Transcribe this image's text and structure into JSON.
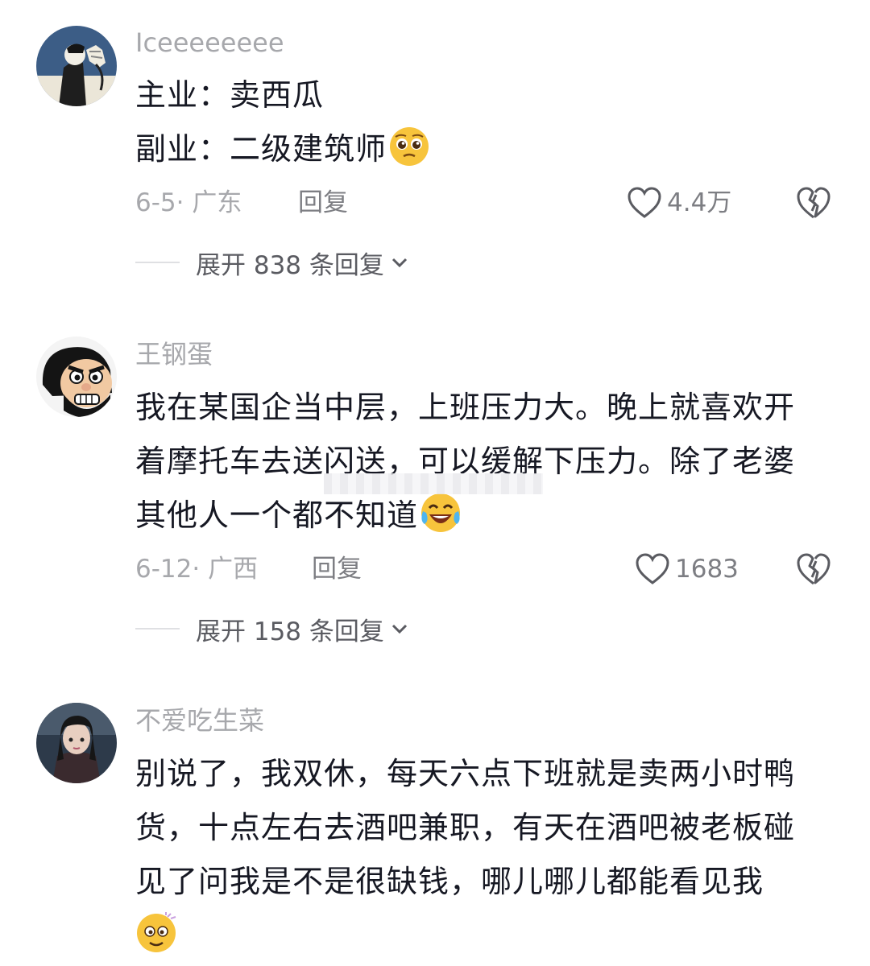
{
  "comments": [
    {
      "username": "Iceeeeeeee",
      "lines": [
        "主业：卖西瓜",
        "副业：二级建筑师"
      ],
      "date_location": "6-5· 广东",
      "reply_label": "回复",
      "likes": "4.4万",
      "expand_label": "展开 838 条回复",
      "emoji": "pleading-face-emoji"
    },
    {
      "username": "王钢蛋",
      "lines": [
        "我在某国企当中层，上班压力大。晚上就喜欢开",
        "着摩托车去送闪送，可以缓解下压力。除了老婆",
        "其他人一个都不知道"
      ],
      "date_location": "6-12· 广西",
      "reply_label": "回复",
      "likes": "1683",
      "expand_label": "展开 158 条回复",
      "emoji": "rolling-laughing-emoji"
    },
    {
      "username": "不爱吃生菜",
      "lines": [
        "别说了，我双休，每天六点下班就是卖两小时鸭",
        "货，十点左右去酒吧兼职，有天在酒吧被老板碰",
        "见了问我是不是很缺钱，哪儿哪儿都能看见我"
      ],
      "emoji": "dizzy-face-emoji"
    }
  ],
  "icons": {
    "like": "heart-outline-icon",
    "dislike": "broken-heart-icon",
    "expand": "chevron-down-icon"
  },
  "colors": {
    "text": "#161823",
    "muted": "#a7a8ac",
    "emoji": "#f7c43c"
  }
}
